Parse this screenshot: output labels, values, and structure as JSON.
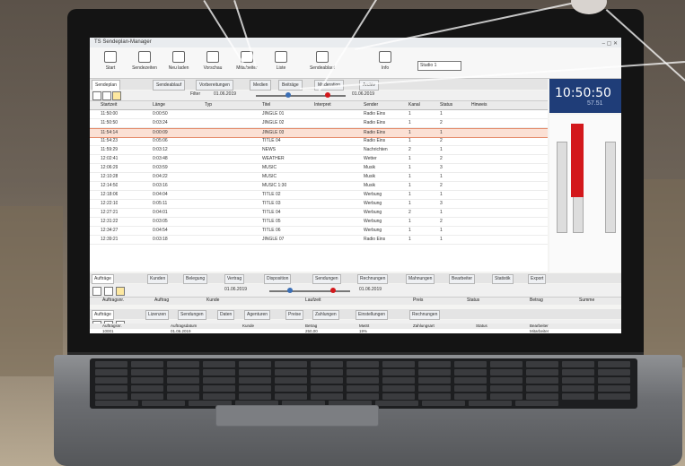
{
  "window": {
    "title": "TS Sendeplan-Manager"
  },
  "ribbon": [
    {
      "icon": "bell-icon",
      "label": "Start"
    },
    {
      "icon": "timer-icon",
      "label": "Sendezeiten"
    },
    {
      "icon": "refresh-icon",
      "label": "Neu laden"
    },
    {
      "icon": "monitor-icon",
      "label": "Vorschau"
    },
    {
      "icon": "group-icon",
      "label": "Mitarbeiter"
    },
    {
      "icon": "list-icon",
      "label": "Liste"
    },
    {
      "icon": "flag-icon",
      "label": "Sendeablauf"
    },
    {
      "icon": "info-icon",
      "label": "Info"
    }
  ],
  "ribbon_dropdown": "Studio 1",
  "top_tabs": [
    "Sendeplan",
    "Sendeablauf",
    "Vorbereitungen",
    "Medien",
    "Beiträge",
    "Moderation",
    "Archiv"
  ],
  "clock": {
    "time": "10:50:50",
    "seconds": "57.51"
  },
  "top_toolbar": {
    "filter": "Filter",
    "range_start": "01.06.2019",
    "range_end": "01.06.2019"
  },
  "table": {
    "headers": [
      "Startzeit",
      "Länge",
      "Typ",
      "Titel",
      "Interpret",
      "Sender",
      "Kanal",
      "Status",
      "Hinweis"
    ],
    "rows": [
      [
        "11:50:00",
        "0:00:50",
        "",
        "JINGLE 01",
        "",
        "Radio Eins",
        "1",
        "1",
        ""
      ],
      [
        "11:50:50",
        "0:03:24",
        "",
        "JINGLE 02",
        "",
        "Radio Eins",
        "1",
        "2",
        ""
      ],
      [
        "11:54:14",
        "0:00:09",
        "",
        "JINGLE 03",
        "",
        "Radio Eins",
        "1",
        "1",
        ""
      ],
      [
        "11:54:23",
        "0:05:06",
        "",
        "TITLE 04",
        "",
        "Radio Eins",
        "1",
        "2",
        ""
      ],
      [
        "11:59:29",
        "0:03:12",
        "",
        "NEWS",
        "",
        "Nachrichten",
        "2",
        "1",
        ""
      ],
      [
        "12:02:41",
        "0:03:48",
        "",
        "WEATHER",
        "",
        "Wetter",
        "1",
        "2",
        ""
      ],
      [
        "12:06:29",
        "0:03:59",
        "",
        "MUSIC",
        "",
        "Musik",
        "1",
        "3",
        ""
      ],
      [
        "12:10:28",
        "0:04:22",
        "",
        "MUSIC",
        "",
        "Musik",
        "1",
        "1",
        ""
      ],
      [
        "12:14:50",
        "0:03:16",
        "",
        "MUSIC 1:30",
        "",
        "Musik",
        "1",
        "2",
        ""
      ],
      [
        "12:18:06",
        "0:04:04",
        "",
        "TITLE 02",
        "",
        "Werbung",
        "1",
        "1",
        ""
      ],
      [
        "12:22:10",
        "0:05:11",
        "",
        "TITLE 03",
        "",
        "Werbung",
        "1",
        "3",
        ""
      ],
      [
        "12:27:21",
        "0:04:01",
        "",
        "TITLE 04",
        "",
        "Werbung",
        "2",
        "1",
        ""
      ],
      [
        "12:31:22",
        "0:03:05",
        "",
        "TITLE 05",
        "",
        "Werbung",
        "1",
        "2",
        ""
      ],
      [
        "12:34:27",
        "0:04:54",
        "",
        "TITLE 06",
        "",
        "Werbung",
        "1",
        "1",
        ""
      ],
      [
        "12:39:21",
        "0:03:18",
        "",
        "JINGLE 07",
        "",
        "Radio Eins",
        "1",
        "1",
        ""
      ]
    ]
  },
  "mid_tabs": [
    "Aufträge",
    "Kunden",
    "Belegung",
    "Vertrag",
    "Disposition",
    "Sendungen",
    "Rechnungen",
    "Mahnungen",
    "Bearbeiter",
    "Statistik",
    "Export"
  ],
  "mid_toolbar": {
    "range_start": "01.06.2019",
    "range_end": "01.06.2019"
  },
  "mid_headers": [
    "Auftragsnr.",
    "Auftrag",
    "Kunde",
    "Laufzeit",
    "Preis",
    "Status",
    "Betrag",
    "Summe"
  ],
  "bottom_tabs": [
    "Aufträge",
    "Lizenzen",
    "Sendungen",
    "Daten",
    "Agenturen",
    "Preise",
    "Zahlungen",
    "Einstellungen",
    "Rechnungen"
  ],
  "bottom_headers": [
    "Auftragsnr.",
    "Auftragsdatum",
    "Kunde",
    "Betrag",
    "MwSt",
    "Zahlungsart",
    "Status",
    "Bearbeiter"
  ],
  "bottom_row": [
    "10001",
    "01.06.2019",
    "",
    "250,00",
    "19%",
    "",
    "",
    "Mitarbeiter"
  ],
  "colors": {
    "accent": "#1f3d78",
    "selected_row": "#fbe0d4",
    "meter_red": "#d3181c"
  }
}
